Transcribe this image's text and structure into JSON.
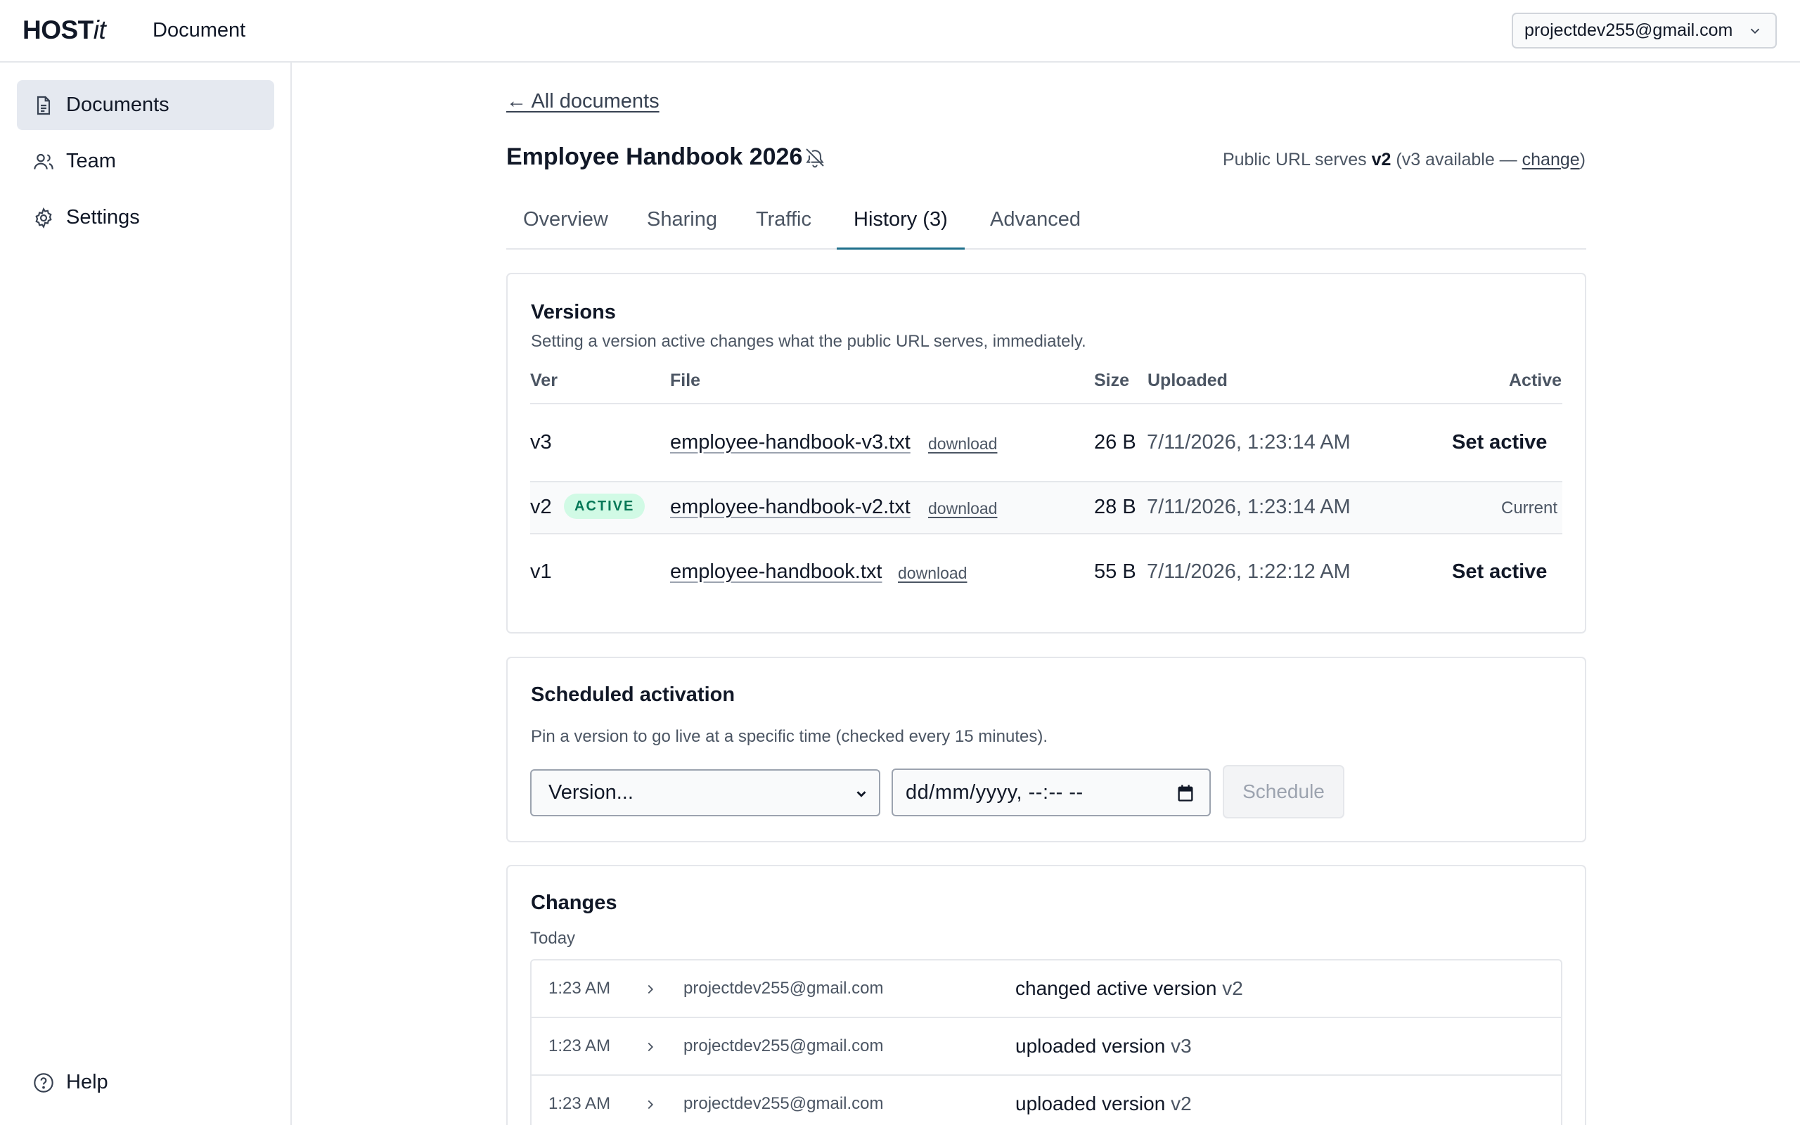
{
  "app": {
    "brand_main": "HOST",
    "brand_italic": "it",
    "page_label": "Document",
    "account_email": "projectdev255@gmail.com"
  },
  "sidebar": {
    "items": [
      {
        "label": "Documents",
        "icon": "document-icon",
        "active": true
      },
      {
        "label": "Team",
        "icon": "users-icon",
        "active": false
      },
      {
        "label": "Settings",
        "icon": "gear-icon",
        "active": false
      }
    ],
    "help_label": "Help"
  },
  "doc": {
    "back_link": "← All documents",
    "title": "Employee Handbook 2026",
    "public_url_prefix": "Public URL serves",
    "public_url_version": "v2",
    "public_url_mid": "(v3 available —",
    "public_url_change": "change",
    "public_url_suffix": ")"
  },
  "tabs": [
    "Overview",
    "Sharing",
    "Traffic",
    "History (3)",
    "Advanced"
  ],
  "active_tab": "History (3)",
  "versions": {
    "title": "Versions",
    "subtitle": "Setting a version active changes what the public URL serves, immediately.",
    "columns": [
      "Ver",
      "File",
      "Size",
      "Uploaded",
      "Active"
    ],
    "download_label": "download",
    "set_active_label": "Set active",
    "current_label": "Current",
    "active_badge": "ACTIVE",
    "rows": [
      {
        "ver": "v3",
        "file": "employee-handbook-v3.txt",
        "size": "26 B",
        "uploaded": "7/11/2026, 1:23:14 AM",
        "active": false
      },
      {
        "ver": "v2",
        "file": "employee-handbook-v2.txt",
        "size": "28 B",
        "uploaded": "7/11/2026, 1:23:14 AM",
        "active": true
      },
      {
        "ver": "v1",
        "file": "employee-handbook.txt",
        "size": "55 B",
        "uploaded": "7/11/2026, 1:22:12 AM",
        "active": false
      }
    ]
  },
  "schedule": {
    "title": "Scheduled activation",
    "subtitle": "Pin a version to go live at a specific time (checked every 15 minutes).",
    "select_value": "Version...",
    "datetime_placeholder": "dd/mm/yyyy, --:-- --",
    "button_label": "Schedule"
  },
  "changes": {
    "title": "Changes",
    "group_label": "Today",
    "rows": [
      {
        "time": "1:23 AM",
        "user": "projectdev255@gmail.com",
        "action": "changed active version",
        "version": "v2"
      },
      {
        "time": "1:23 AM",
        "user": "projectdev255@gmail.com",
        "action": "uploaded version",
        "version": "v3"
      },
      {
        "time": "1:23 AM",
        "user": "projectdev255@gmail.com",
        "action": "uploaded version",
        "version": "v2"
      }
    ]
  }
}
